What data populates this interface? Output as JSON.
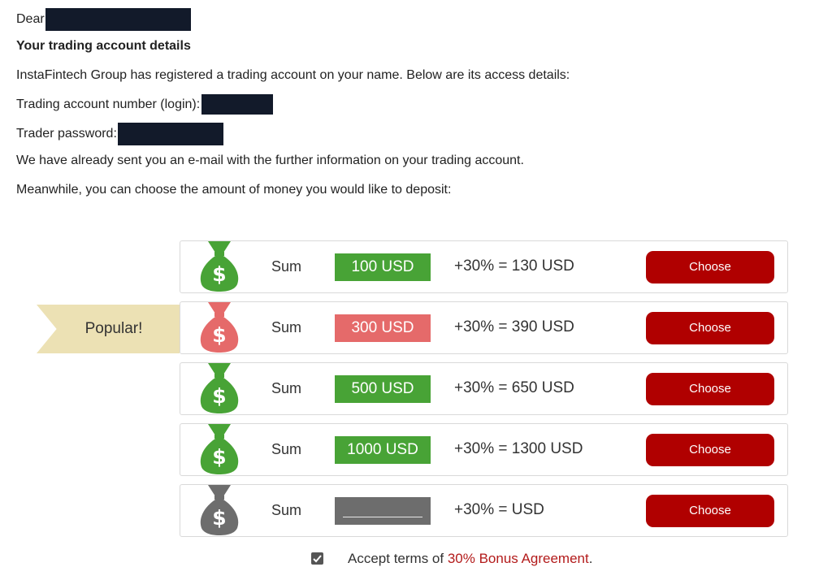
{
  "greeting": {
    "label": "Dear"
  },
  "heading": "Your trading account details",
  "registered_text": "InstaFintech Group has registered a trading account on your name. Below are its access details:",
  "account_number_label": "Trading account number (login):",
  "password_label": "Trader password:",
  "email_sent_text": "We have already sent you an e-mail with the further information on your trading account.",
  "deposit_prompt": "Meanwhile, you can choose the amount of money you would like to deposit:",
  "popular_badge": "Popular!",
  "offers": [
    {
      "sum_label": "Sum",
      "amount": "100 USD",
      "bonus": "+30% = 130 USD",
      "button": "Choose",
      "color": "#48a336"
    },
    {
      "sum_label": "Sum",
      "amount": "300 USD",
      "bonus": "+30% = 390 USD",
      "button": "Choose",
      "color": "#e56a6a"
    },
    {
      "sum_label": "Sum",
      "amount": "500 USD",
      "bonus": "+30% = 650 USD",
      "button": "Choose",
      "color": "#48a336"
    },
    {
      "sum_label": "Sum",
      "amount": "1000 USD",
      "bonus": "+30% = 1300 USD",
      "button": "Choose",
      "color": "#48a336"
    },
    {
      "sum_label": "Sum",
      "amount": "",
      "bonus": "+30% =  USD",
      "button": "Choose",
      "color": "#6d6d6d"
    }
  ],
  "terms": {
    "prefix": "Accept terms of ",
    "link": "30% Bonus Agreement",
    "suffix": ".",
    "checked": true
  },
  "colors": {
    "accent_red": "#b00000",
    "green": "#48a336",
    "pink": "#e56a6a",
    "ribbon": "#ece1b4"
  }
}
